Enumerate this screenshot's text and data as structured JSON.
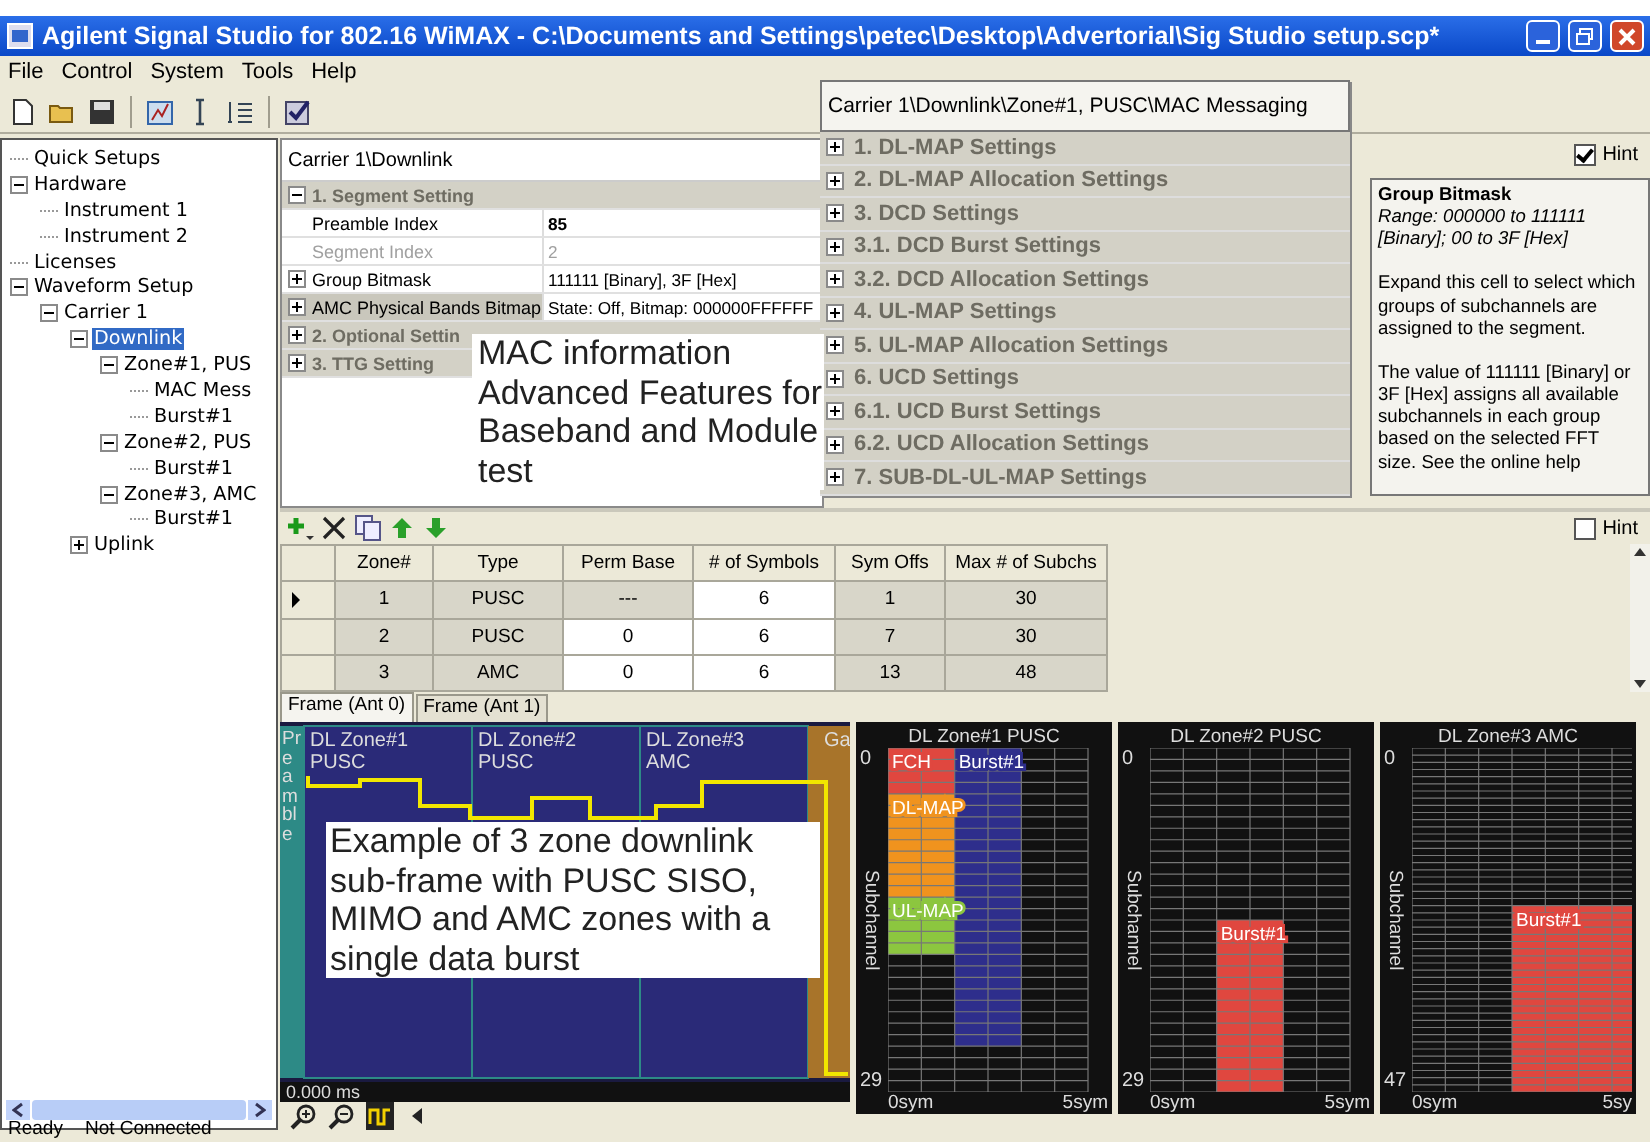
{
  "window": {
    "title": "Agilent Signal Studio for 802.16 WiMAX - C:\\Documents and Settings\\petec\\Desktop\\Advertorial\\Sig Studio setup.scp*"
  },
  "menu": [
    "File",
    "Control",
    "System",
    "Tools",
    "Help"
  ],
  "tree": {
    "items": [
      {
        "label": "Quick Setups",
        "selected": false
      },
      {
        "label": "Hardware",
        "selected": false,
        "expanded": true,
        "children": [
          {
            "label": "Instrument 1",
            "selected": false
          },
          {
            "label": "Instrument 2",
            "selected": false
          }
        ]
      },
      {
        "label": "Licenses",
        "selected": false
      },
      {
        "label": "Waveform Setup",
        "selected": false,
        "expanded": true,
        "children": [
          {
            "label": "Carrier 1",
            "selected": false,
            "expanded": true,
            "children": [
              {
                "label": "Downlink",
                "selected": true,
                "expanded": true,
                "children": [
                  {
                    "label": "Zone#1, PUS",
                    "selected": false,
                    "expanded": true,
                    "children": [
                      {
                        "label": "MAC Mess",
                        "selected": false
                      },
                      {
                        "label": "Burst#1",
                        "selected": false
                      }
                    ]
                  },
                  {
                    "label": "Zone#2, PUS",
                    "selected": false,
                    "expanded": true,
                    "children": [
                      {
                        "label": "Burst#1",
                        "selected": false
                      }
                    ]
                  },
                  {
                    "label": "Zone#3, AMC",
                    "selected": false,
                    "expanded": true,
                    "children": [
                      {
                        "label": "Burst#1",
                        "selected": false
                      }
                    ]
                  }
                ]
              },
              {
                "label": "Uplink",
                "selected": false,
                "expanded": false
              }
            ]
          }
        ]
      }
    ]
  },
  "properties": {
    "path": "Carrier 1\\Downlink",
    "rows": [
      {
        "kind": "section",
        "label": "1. Segment Setting",
        "expanded": true
      },
      {
        "kind": "property",
        "label": "Preamble Index",
        "value": "85",
        "modified": true,
        "disabled": false,
        "selected": false
      },
      {
        "kind": "property",
        "label": "Segment Index",
        "value": "2",
        "modified": false,
        "disabled": true,
        "selected": false
      },
      {
        "kind": "property",
        "label": "Group Bitmask",
        "value": "111111 [Binary], 3F [Hex]",
        "expandable": true,
        "modified": false,
        "disabled": false,
        "selected": false
      },
      {
        "kind": "property",
        "label": "AMC Physical Bands Bitmap",
        "value": "State: Off, Bitmap: 000000FFFFFF",
        "expandable": true,
        "modified": false,
        "disabled": false,
        "selected": true
      },
      {
        "kind": "section",
        "label": "2. Optional Settin",
        "expanded": false
      },
      {
        "kind": "section",
        "label": "3. TTG Setting",
        "expanded": false
      }
    ]
  },
  "mac_panel": {
    "path": "Carrier 1\\Downlink\\Zone#1, PUSC\\MAC Messaging",
    "sections": [
      {
        "label": "1. DL-MAP Settings",
        "expanded": false
      },
      {
        "label": "2. DL-MAP Allocation Settings",
        "expanded": false
      },
      {
        "label": "3. DCD Settings",
        "expanded": false
      },
      {
        "label": "3.1. DCD Burst Settings",
        "expanded": false
      },
      {
        "label": "3.2. DCD Allocation Settings",
        "expanded": false
      },
      {
        "label": "4. UL-MAP Settings",
        "expanded": false
      },
      {
        "label": "5. UL-MAP Allocation Settings",
        "expanded": false
      },
      {
        "label": "6. UCD Settings",
        "expanded": false
      },
      {
        "label": "6.1. UCD Burst Settings",
        "expanded": false
      },
      {
        "label": "6.2. UCD Allocation Settings",
        "expanded": false
      },
      {
        "label": "7. SUB-DL-UL-MAP Settings",
        "expanded": false
      }
    ]
  },
  "hint": {
    "label": "Hint",
    "checked": true,
    "title": "Group Bitmask",
    "range": "Range: 000000 to 111111 [Binary];  00 to 3F [Hex]",
    "paragraphs": [
      "Expand this cell to select which groups of subchannels are assigned to the segment.",
      "The value of 111111 [Binary] or 3F [Hex] assigns all available subchannels in each group based on the selected FFT size. See the online help"
    ]
  },
  "callout_top": "MAC information Advanced Features for Baseband and Module test",
  "zone_table": {
    "hint": {
      "label": "Hint",
      "checked": false
    },
    "columns": [
      "Zone#",
      "Type",
      "Perm Base",
      "# of Symbols",
      "Sym Offs",
      "Max # of Subchs"
    ],
    "rows": [
      {
        "selected": true,
        "cells": [
          {
            "text": "1",
            "editable": false
          },
          {
            "text": "PUSC",
            "editable": false
          },
          {
            "text": "---",
            "editable": false
          },
          {
            "text": "6",
            "editable": true
          },
          {
            "text": "1",
            "editable": false
          },
          {
            "text": "30",
            "editable": false
          }
        ]
      },
      {
        "selected": false,
        "cells": [
          {
            "text": "2",
            "editable": false
          },
          {
            "text": "PUSC",
            "editable": false
          },
          {
            "text": "0",
            "editable": true
          },
          {
            "text": "6",
            "editable": true
          },
          {
            "text": "7",
            "editable": false
          },
          {
            "text": "30",
            "editable": false
          }
        ]
      },
      {
        "selected": false,
        "cells": [
          {
            "text": "3",
            "editable": false
          },
          {
            "text": "AMC",
            "editable": false
          },
          {
            "text": "0",
            "editable": true
          },
          {
            "text": "6",
            "editable": true
          },
          {
            "text": "13",
            "editable": false
          },
          {
            "text": "48",
            "editable": false
          }
        ]
      }
    ]
  },
  "frame_tabs": [
    {
      "label": "Frame (Ant 0)",
      "selected": true
    },
    {
      "label": "Frame (Ant 1)",
      "selected": false
    }
  ],
  "frame": {
    "segments": [
      {
        "kind": "preamble",
        "name": "Preamble"
      },
      {
        "kind": "zone",
        "name": "DL Zone#1",
        "type": "PUSC"
      },
      {
        "kind": "zone",
        "name": "DL Zone#2",
        "type": "PUSC"
      },
      {
        "kind": "zone",
        "name": "DL Zone#3",
        "type": "AMC"
      },
      {
        "kind": "gap",
        "name": "Ga"
      }
    ],
    "time": "0.000 ms",
    "callout": "Example of 3 zone downlink sub-frame with PUSC SISO, MIMO and AMC zones with a single data burst"
  },
  "zone_maps": [
    {
      "title": "DL Zone#1 PUSC",
      "y_start": "0",
      "y_end": "29",
      "y_label": "Subchannel",
      "x_start": "0sym",
      "x_end": "5sym",
      "blocks": [
        {
          "label": "FCH",
          "color": "#e0473f"
        },
        {
          "label": "DL-MAP",
          "color": "#f0931e"
        },
        {
          "label": "UL-MAP",
          "color": "#8cc63f"
        },
        {
          "label": "Burst#1",
          "color": "#2e2e8c"
        }
      ]
    },
    {
      "title": "DL Zone#2 PUSC",
      "y_start": "0",
      "y_end": "29",
      "y_label": "Subchannel",
      "x_start": "0sym",
      "x_end": "5sym",
      "blocks": [
        {
          "label": "Burst#1",
          "color": "#e0473f"
        }
      ]
    },
    {
      "title": "DL Zone#3 AMC",
      "y_start": "0",
      "y_end": "47",
      "y_label": "Subchannel",
      "x_start": "0sym",
      "x_end": "5sy",
      "blocks": [
        {
          "label": "Burst#1",
          "color": "#e0473f"
        }
      ]
    }
  ],
  "status_bar": [
    "Ready",
    "Not Connected"
  ]
}
